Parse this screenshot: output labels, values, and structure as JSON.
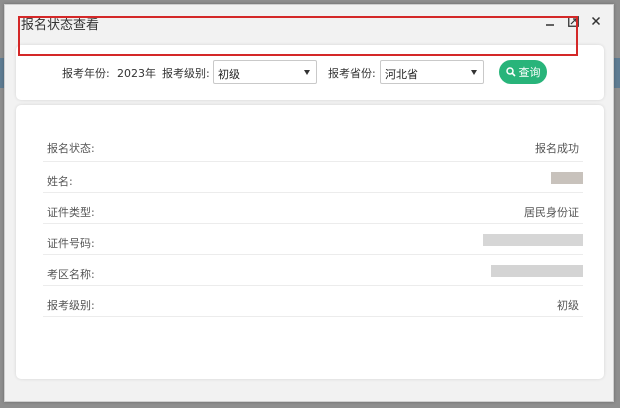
{
  "dialog": {
    "title": "报名状态查看",
    "controls": {
      "minimize_icon": "minus-icon",
      "maximize_icon": "maximize-icon",
      "close_icon": "close-icon"
    }
  },
  "query": {
    "year_label": "报考年份:",
    "year_value": "2023年",
    "level_label": "报考级别:",
    "level_selected": "初级",
    "province_label": "报考省份:",
    "province_selected": "河北省",
    "search_button": "查询",
    "search_icon": "search-icon"
  },
  "result": {
    "rows": [
      {
        "label": "报名状态:",
        "value": "报名成功"
      },
      {
        "label": "姓名:",
        "value": ""
      },
      {
        "label": "证件类型:",
        "value": "居民身份证"
      },
      {
        "label": "证件号码:",
        "value": ""
      },
      {
        "label": "考区名称:",
        "value": ""
      },
      {
        "label": "报考级别:",
        "value": "初级"
      }
    ]
  },
  "colors": {
    "accent": "#28b47a",
    "highlight": "#d42828"
  }
}
